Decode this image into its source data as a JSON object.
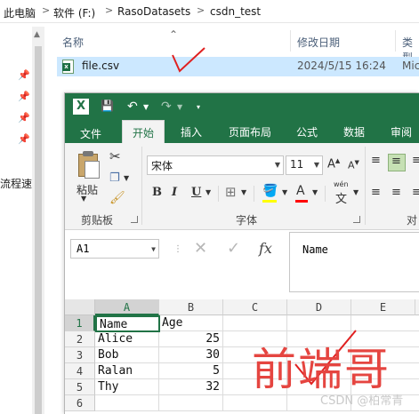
{
  "explorer": {
    "breadcrumb": [
      "此电脑",
      "软件 (F:)",
      "RasoDatasets",
      "csdn_test"
    ],
    "left_pane_label": "流程速",
    "columns": {
      "name": "名称",
      "date": "修改日期",
      "type": "类型"
    },
    "file": {
      "name": "file.csv",
      "date": "2024/5/15 16:24",
      "type": "Mic"
    }
  },
  "excel": {
    "tabs": {
      "file": "文件",
      "home": "开始",
      "insert": "插入",
      "page_layout": "页面布局",
      "formulas": "公式",
      "data": "数据",
      "review": "审阅"
    },
    "ribbon": {
      "paste_label": "粘贴",
      "clipboard_group": "剪贴板",
      "font_group": "字体",
      "font_name": "宋体",
      "font_size": "11",
      "bold": "B",
      "italic": "I",
      "underline": "U",
      "font_color_letter": "A",
      "wen": "wén",
      "wen_char": "文",
      "grow_font": "A",
      "shrink_font": "A",
      "align_group_partial": "对"
    },
    "name_box": "A1",
    "fx": "fx",
    "formula_value": "Name",
    "column_headers": [
      "A",
      "B",
      "C",
      "D",
      "E"
    ],
    "row_headers": [
      "1",
      "2",
      "3",
      "4",
      "5",
      "6"
    ],
    "rows": [
      [
        "Name",
        "Age"
      ],
      [
        "Alice",
        "25"
      ],
      [
        "Bob",
        "30"
      ],
      [
        "Ralan",
        "5"
      ],
      [
        "Thy",
        "32"
      ]
    ]
  },
  "overlay": {
    "annotation_text": "前端哥",
    "watermark": "CSDN @柏常青",
    "annotation_color": "#e54540"
  },
  "theme": {
    "excel_green": "#217346",
    "selection_blue": "#cce8ff"
  }
}
